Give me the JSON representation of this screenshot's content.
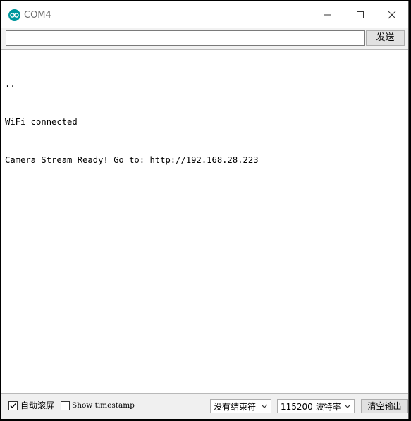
{
  "window": {
    "title": "COM4"
  },
  "input": {
    "value": "",
    "placeholder": ""
  },
  "send_label": "发送",
  "output_lines": [
    "..",
    "WiFi connected",
    "Camera Stream Ready! Go to: http://192.168.28.223"
  ],
  "status": {
    "autoscroll_label": "自动滚屏",
    "autoscroll_checked": true,
    "timestamp_label": "Show timestamp",
    "timestamp_checked": false,
    "line_ending": "没有结束符",
    "baud": "115200 波特率",
    "clear_label": "清空输出"
  },
  "colors": {
    "app_icon": "#00979d",
    "background": "#ffffff"
  },
  "icons": {
    "app": "arduino-icon",
    "minimize": "minimize-icon",
    "maximize": "maximize-icon",
    "close": "close-icon",
    "dropdown": "chevron-down-icon",
    "check": "check-icon"
  }
}
